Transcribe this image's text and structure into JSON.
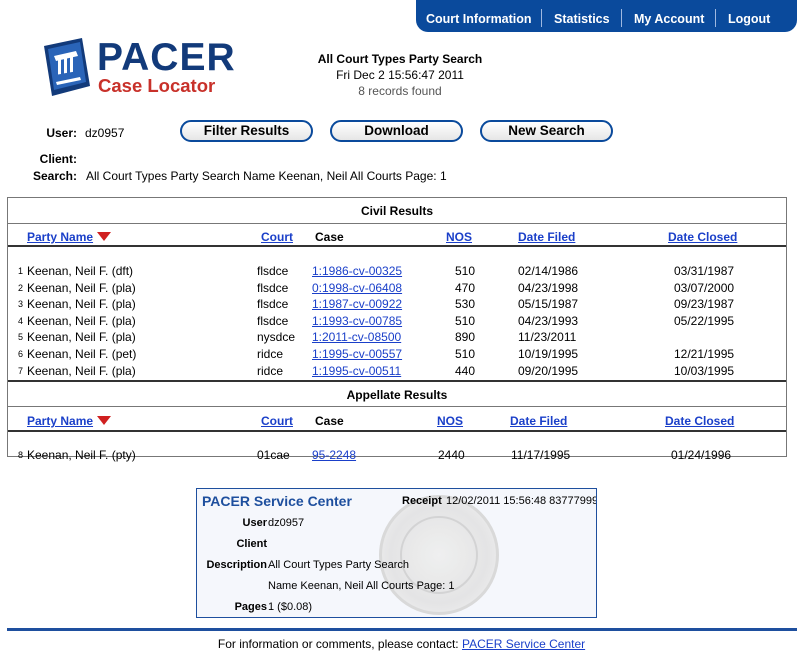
{
  "nav": {
    "court_information": "Court Information",
    "statistics": "Statistics",
    "my_account": "My Account",
    "logout": "Logout"
  },
  "logo": {
    "word": "PACER",
    "sub": "Case Locator"
  },
  "header": {
    "title": "All Court Types Party Search",
    "datetime": "Fri Dec 2 15:56:47 2011",
    "records": "8 records found"
  },
  "meta": {
    "user_label": "User:",
    "user_value": "dz0957",
    "client_label": "Client:",
    "client_value": "",
    "search_label": "Search:",
    "search_value": "All Court Types Party Search Name Keenan, Neil All Courts Page: 1"
  },
  "buttons": {
    "filter": "Filter Results",
    "download": "Download",
    "new_search": "New Search"
  },
  "civil": {
    "title": "Civil Results",
    "headers": {
      "party": "Party Name",
      "court": "Court",
      "case": "Case",
      "nos": "NOS",
      "filed": "Date Filed",
      "closed": "Date Closed"
    },
    "rows": [
      {
        "n": "1",
        "party": "Keenan, Neil F. (dft)",
        "court": "flsdce",
        "case": "1:1986-cv-00325",
        "nos": "510",
        "filed": "02/14/1986",
        "closed": "03/31/1987"
      },
      {
        "n": "2",
        "party": "Keenan, Neil F. (pla)",
        "court": "flsdce",
        "case": "0:1998-cv-06408",
        "nos": "470",
        "filed": "04/23/1998",
        "closed": "03/07/2000"
      },
      {
        "n": "3",
        "party": "Keenan, Neil F. (pla)",
        "court": "flsdce",
        "case": "1:1987-cv-00922",
        "nos": "530",
        "filed": "05/15/1987",
        "closed": "09/23/1987"
      },
      {
        "n": "4",
        "party": "Keenan, Neil F. (pla)",
        "court": "flsdce",
        "case": "1:1993-cv-00785",
        "nos": "510",
        "filed": "04/23/1993",
        "closed": "05/22/1995"
      },
      {
        "n": "5",
        "party": "Keenan, Neil F. (pla)",
        "court": "nysdce",
        "case": "1:2011-cv-08500",
        "nos": "890",
        "filed": "11/23/2011",
        "closed": ""
      },
      {
        "n": "6",
        "party": "Keenan, Neil F. (pet)",
        "court": "ridce",
        "case": "1:1995-cv-00557",
        "nos": "510",
        "filed": "10/19/1995",
        "closed": "12/21/1995"
      },
      {
        "n": "7",
        "party": "Keenan, Neil F. (pla)",
        "court": "ridce",
        "case": "1:1995-cv-00511",
        "nos": "440",
        "filed": "09/20/1995",
        "closed": "10/03/1995"
      }
    ]
  },
  "appellate": {
    "title": "Appellate Results",
    "headers": {
      "party": "Party Name",
      "court": "Court",
      "case": "Case",
      "nos": "NOS",
      "filed": "Date Filed",
      "closed": "Date Closed"
    },
    "rows": [
      {
        "n": "8",
        "party": "Keenan, Neil F. (pty)",
        "court": "01cae",
        "case": "95-2248",
        "nos": "2440",
        "filed": "11/17/1995",
        "closed": "01/24/1996"
      }
    ]
  },
  "service": {
    "title": "PACER Service Center",
    "receipt_label": "Receipt",
    "receipt_value": "12/02/2011 15:56:48 83777999",
    "user_label": "User",
    "user_value": "dz0957",
    "client_label": "Client",
    "client_value": "",
    "description_label": "Description",
    "description_line1": "All Court Types Party Search",
    "description_line2": "Name Keenan, Neil All Courts Page: 1",
    "pages_label": "Pages",
    "pages_value": "1 ($0.08)"
  },
  "footer": {
    "text": "For information or comments, please contact: ",
    "link": "PACER Service Center"
  },
  "colors": {
    "brand_blue": "#0a4a9c",
    "brand_red": "#c8312a",
    "link": "#1a3fc9",
    "sort_arrow": "#d02020"
  },
  "icons": {
    "logo": "courthouse-columns-icon",
    "sort": "sort-descending-triangle-icon",
    "seal": "judiciary-seal-watermark"
  }
}
